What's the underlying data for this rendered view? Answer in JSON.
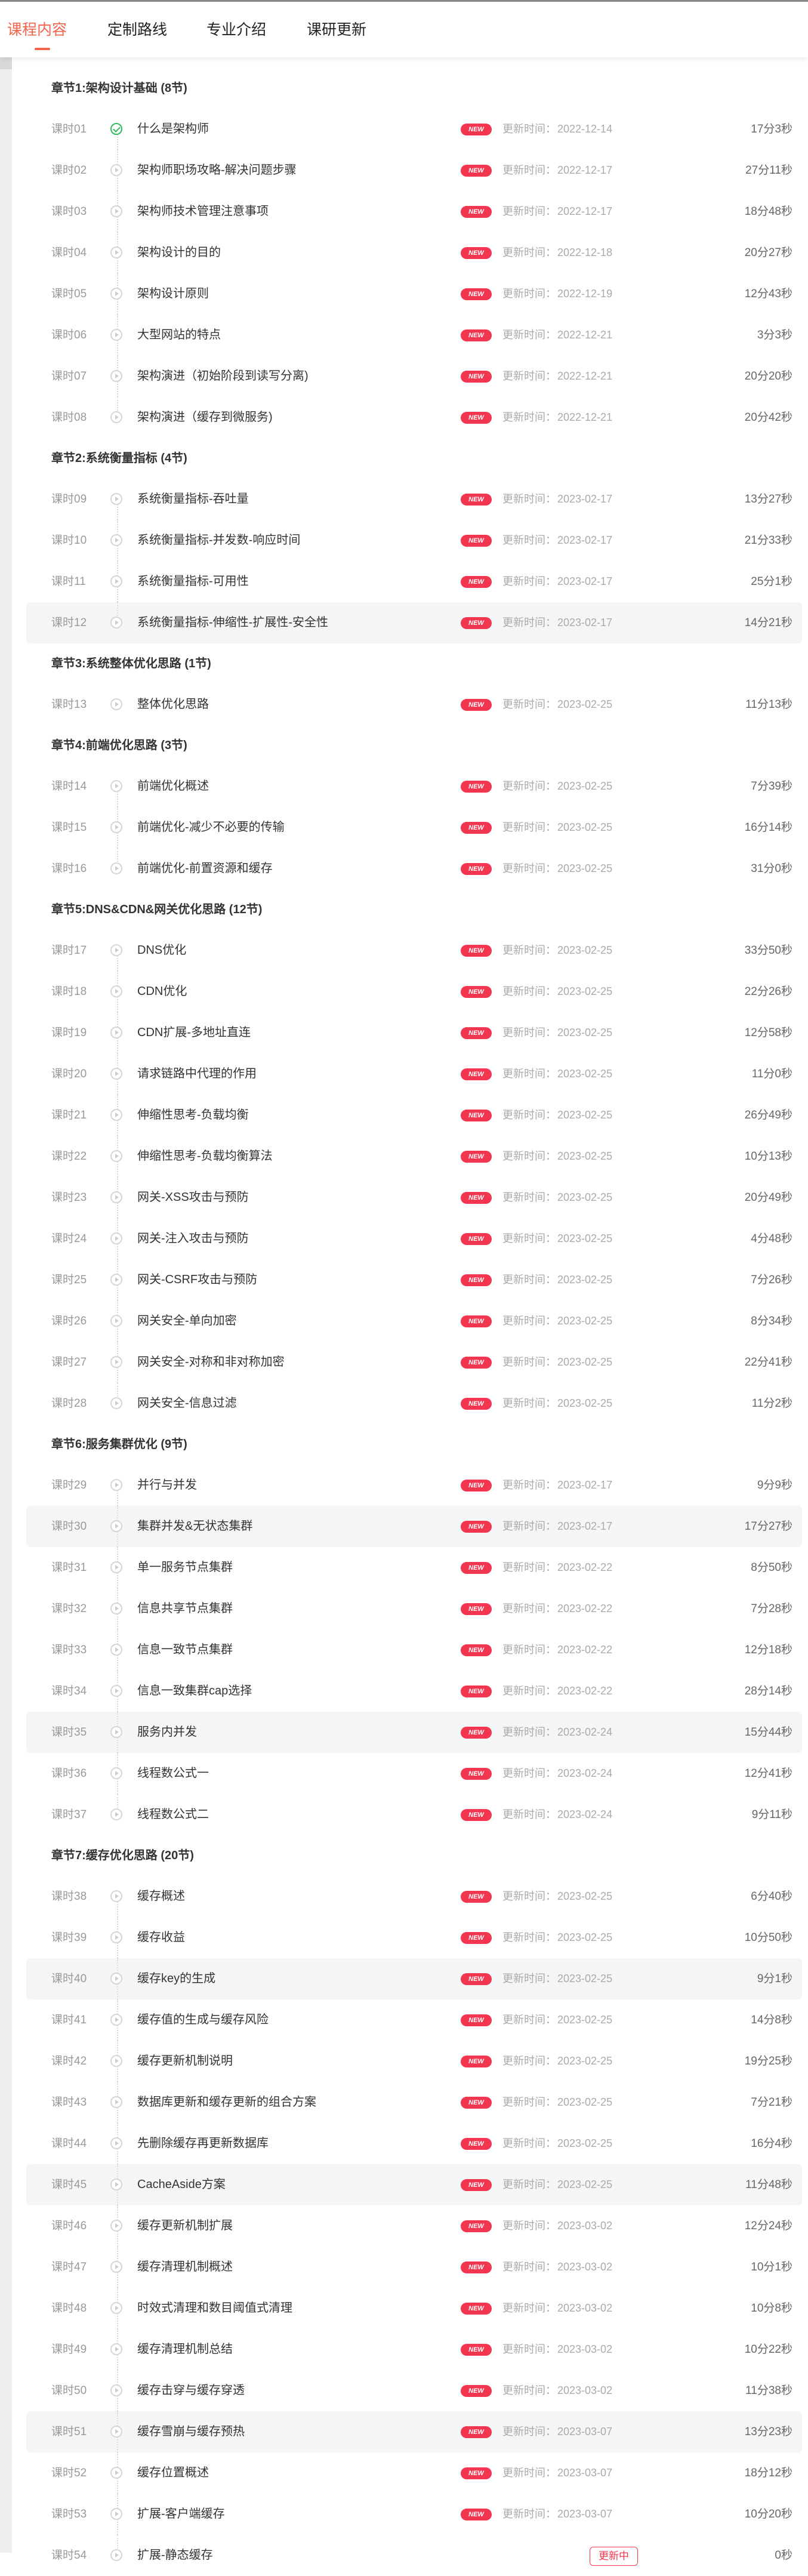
{
  "tabs": [
    {
      "label": "课程内容",
      "active": true
    },
    {
      "label": "定制路线",
      "active": false
    },
    {
      "label": "专业介绍",
      "active": false
    },
    {
      "label": "课研更新",
      "active": false
    }
  ],
  "accent_color": "#f2644d",
  "badge_color": "#f2364f",
  "labels": {
    "badge": "NEW",
    "updated_prefix": "更新时间：",
    "updating": "更新中"
  },
  "chapters": [
    {
      "title": "章节1:架构设计基础 (8节)",
      "lessons": [
        {
          "num": "课时01",
          "title": "什么是架构师",
          "date": "2022-12-14",
          "duration": "17分3秒",
          "status": "done"
        },
        {
          "num": "课时02",
          "title": "架构师职场攻略-解决问题步骤",
          "date": "2022-12-17",
          "duration": "27分11秒"
        },
        {
          "num": "课时03",
          "title": "架构师技术管理注意事项",
          "date": "2022-12-17",
          "duration": "18分48秒"
        },
        {
          "num": "课时04",
          "title": "架构设计的目的",
          "date": "2022-12-18",
          "duration": "20分27秒"
        },
        {
          "num": "课时05",
          "title": "架构设计原则",
          "date": "2022-12-19",
          "duration": "12分43秒"
        },
        {
          "num": "课时06",
          "title": "大型网站的特点",
          "date": "2022-12-21",
          "duration": "3分3秒"
        },
        {
          "num": "课时07",
          "title": "架构演进（初始阶段到读写分离)",
          "date": "2022-12-21",
          "duration": "20分20秒"
        },
        {
          "num": "课时08",
          "title": "架构演进（缓存到微服务)",
          "date": "2022-12-21",
          "duration": "20分42秒"
        }
      ]
    },
    {
      "title": "章节2:系统衡量指标 (4节)",
      "lessons": [
        {
          "num": "课时09",
          "title": "系统衡量指标-吞吐量",
          "date": "2023-02-17",
          "duration": "13分27秒"
        },
        {
          "num": "课时10",
          "title": "系统衡量指标-并发数-响应时间",
          "date": "2023-02-17",
          "duration": "21分33秒"
        },
        {
          "num": "课时11",
          "title": "系统衡量指标-可用性",
          "date": "2023-02-17",
          "duration": "25分1秒"
        },
        {
          "num": "课时12",
          "title": "系统衡量指标-伸缩性-扩展性-安全性",
          "date": "2023-02-17",
          "duration": "14分21秒",
          "highlight": true
        }
      ]
    },
    {
      "title": "章节3:系统整体优化思路 (1节)",
      "lessons": [
        {
          "num": "课时13",
          "title": "整体优化思路",
          "date": "2023-02-25",
          "duration": "11分13秒"
        }
      ]
    },
    {
      "title": "章节4:前端优化思路 (3节)",
      "lessons": [
        {
          "num": "课时14",
          "title": "前端优化概述",
          "date": "2023-02-25",
          "duration": "7分39秒"
        },
        {
          "num": "课时15",
          "title": "前端优化-减少不必要的传输",
          "date": "2023-02-25",
          "duration": "16分14秒"
        },
        {
          "num": "课时16",
          "title": "前端优化-前置资源和缓存",
          "date": "2023-02-25",
          "duration": "31分0秒"
        }
      ]
    },
    {
      "title": "章节5:DNS&CDN&网关优化思路 (12节)",
      "lessons": [
        {
          "num": "课时17",
          "title": "DNS优化",
          "date": "2023-02-25",
          "duration": "33分50秒"
        },
        {
          "num": "课时18",
          "title": "CDN优化",
          "date": "2023-02-25",
          "duration": "22分26秒"
        },
        {
          "num": "课时19",
          "title": "CDN扩展-多地址直连",
          "date": "2023-02-25",
          "duration": "12分58秒"
        },
        {
          "num": "课时20",
          "title": "请求链路中代理的作用",
          "date": "2023-02-25",
          "duration": "11分0秒"
        },
        {
          "num": "课时21",
          "title": "伸缩性思考-负载均衡",
          "date": "2023-02-25",
          "duration": "26分49秒"
        },
        {
          "num": "课时22",
          "title": "伸缩性思考-负载均衡算法",
          "date": "2023-02-25",
          "duration": "10分13秒"
        },
        {
          "num": "课时23",
          "title": "网关-XSS攻击与预防",
          "date": "2023-02-25",
          "duration": "20分49秒"
        },
        {
          "num": "课时24",
          "title": "网关-注入攻击与预防",
          "date": "2023-02-25",
          "duration": "4分48秒"
        },
        {
          "num": "课时25",
          "title": "网关-CSRF攻击与预防",
          "date": "2023-02-25",
          "duration": "7分26秒"
        },
        {
          "num": "课时26",
          "title": "网关安全-单向加密",
          "date": "2023-02-25",
          "duration": "8分34秒"
        },
        {
          "num": "课时27",
          "title": "网关安全-对称和非对称加密",
          "date": "2023-02-25",
          "duration": "22分41秒"
        },
        {
          "num": "课时28",
          "title": "网关安全-信息过滤",
          "date": "2023-02-25",
          "duration": "11分2秒"
        }
      ]
    },
    {
      "title": "章节6:服务集群优化 (9节)",
      "lessons": [
        {
          "num": "课时29",
          "title": "并行与并发",
          "date": "2023-02-17",
          "duration": "9分9秒"
        },
        {
          "num": "课时30",
          "title": "集群并发&无状态集群",
          "date": "2023-02-17",
          "duration": "17分27秒",
          "highlight": true
        },
        {
          "num": "课时31",
          "title": "单一服务节点集群",
          "date": "2023-02-22",
          "duration": "8分50秒"
        },
        {
          "num": "课时32",
          "title": "信息共享节点集群",
          "date": "2023-02-22",
          "duration": "7分28秒"
        },
        {
          "num": "课时33",
          "title": "信息一致节点集群",
          "date": "2023-02-22",
          "duration": "12分18秒"
        },
        {
          "num": "课时34",
          "title": "信息一致集群cap选择",
          "date": "2023-02-22",
          "duration": "28分14秒"
        },
        {
          "num": "课时35",
          "title": "服务内并发",
          "date": "2023-02-24",
          "duration": "15分44秒",
          "highlight": true
        },
        {
          "num": "课时36",
          "title": "线程数公式一",
          "date": "2023-02-24",
          "duration": "12分41秒"
        },
        {
          "num": "课时37",
          "title": "线程数公式二",
          "date": "2023-02-24",
          "duration": "9分11秒"
        }
      ]
    },
    {
      "title": "章节7:缓存优化思路 (20节)",
      "lessons": [
        {
          "num": "课时38",
          "title": "缓存概述",
          "date": "2023-02-25",
          "duration": "6分40秒"
        },
        {
          "num": "课时39",
          "title": "缓存收益",
          "date": "2023-02-25",
          "duration": "10分50秒"
        },
        {
          "num": "课时40",
          "title": "缓存key的生成",
          "date": "2023-02-25",
          "duration": "9分1秒",
          "highlight": true
        },
        {
          "num": "课时41",
          "title": "缓存值的生成与缓存风险",
          "date": "2023-02-25",
          "duration": "14分8秒"
        },
        {
          "num": "课时42",
          "title": "缓存更新机制说明",
          "date": "2023-02-25",
          "duration": "19分25秒"
        },
        {
          "num": "课时43",
          "title": "数据库更新和缓存更新的组合方案",
          "date": "2023-02-25",
          "duration": "7分21秒"
        },
        {
          "num": "课时44",
          "title": "先删除缓存再更新数据库",
          "date": "2023-02-25",
          "duration": "16分4秒"
        },
        {
          "num": "课时45",
          "title": "CacheAside方案",
          "date": "2023-02-25",
          "duration": "11分48秒",
          "highlight": true
        },
        {
          "num": "课时46",
          "title": "缓存更新机制扩展",
          "date": "2023-03-02",
          "duration": "12分24秒"
        },
        {
          "num": "课时47",
          "title": "缓存清理机制概述",
          "date": "2023-03-02",
          "duration": "10分1秒"
        },
        {
          "num": "课时48",
          "title": "时效式清理和数目阈值式清理",
          "date": "2023-03-02",
          "duration": "10分8秒"
        },
        {
          "num": "课时49",
          "title": "缓存清理机制总结",
          "date": "2023-03-02",
          "duration": "10分22秒"
        },
        {
          "num": "课时50",
          "title": "缓存击穿与缓存穿透",
          "date": "2023-03-02",
          "duration": "11分38秒"
        },
        {
          "num": "课时51",
          "title": "缓存雪崩与缓存预热",
          "date": "2023-03-07",
          "duration": "13分23秒",
          "highlight": true
        },
        {
          "num": "课时52",
          "title": "缓存位置概述",
          "date": "2023-03-07",
          "duration": "18分12秒"
        },
        {
          "num": "课时53",
          "title": "扩展-客户端缓存",
          "date": "2023-03-07",
          "duration": "10分20秒"
        },
        {
          "num": "课时54",
          "title": "扩展-静态缓存",
          "date": "",
          "duration": "0秒",
          "status": "updating"
        }
      ]
    }
  ]
}
